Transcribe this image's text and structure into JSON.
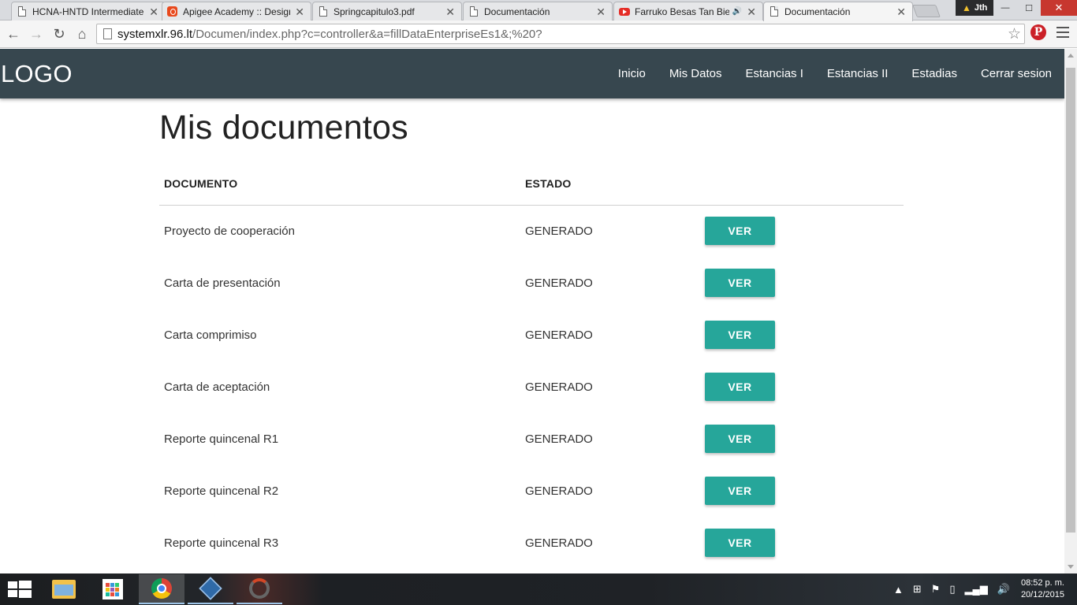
{
  "browser": {
    "tabs": [
      {
        "title": "HCNA-HNTD Intermediate",
        "icon": "document-icon"
      },
      {
        "title": "Apigee Academy :: Design",
        "icon": "apigee-icon"
      },
      {
        "title": "Springcapitulo3.pdf",
        "icon": "document-icon"
      },
      {
        "title": "Documentación",
        "icon": "document-icon"
      },
      {
        "title": "Farruko Besas Tan Bien",
        "icon": "youtube-icon"
      },
      {
        "title": "Documentación",
        "icon": "document-icon"
      }
    ],
    "profile_name": "Jth",
    "url_host": "systemxlr.96.lt",
    "url_path": "/Documen/index.php?c=controller&a=fillDataEnterpriseEs1&;%20?"
  },
  "site": {
    "logo": "LOGO",
    "nav": [
      "Inicio",
      "Mis Datos",
      "Estancias I",
      "Estancias II",
      "Estadias",
      "Cerrar sesion"
    ],
    "nav_color": "#37474f",
    "accent_color": "#26a69a"
  },
  "page": {
    "title": "Mis documentos",
    "table": {
      "headers": [
        "DOCUMENTO",
        "ESTADO"
      ],
      "rows": [
        {
          "documento": "Proyecto de cooperación",
          "estado": "GENERADO",
          "action": "VER"
        },
        {
          "documento": "Carta de presentación",
          "estado": "GENERADO",
          "action": "VER"
        },
        {
          "documento": "Carta comprimiso",
          "estado": "GENERADO",
          "action": "VER"
        },
        {
          "documento": "Carta de aceptación",
          "estado": "GENERADO",
          "action": "VER"
        },
        {
          "documento": "Reporte quincenal R1",
          "estado": "GENERADO",
          "action": "VER"
        },
        {
          "documento": "Reporte quincenal R2",
          "estado": "GENERADO",
          "action": "VER"
        },
        {
          "documento": "Reporte quincenal R3",
          "estado": "GENERADO",
          "action": "VER"
        }
      ]
    }
  },
  "taskbar": {
    "time": "08:52 p. m.",
    "date": "20/12/2015"
  }
}
